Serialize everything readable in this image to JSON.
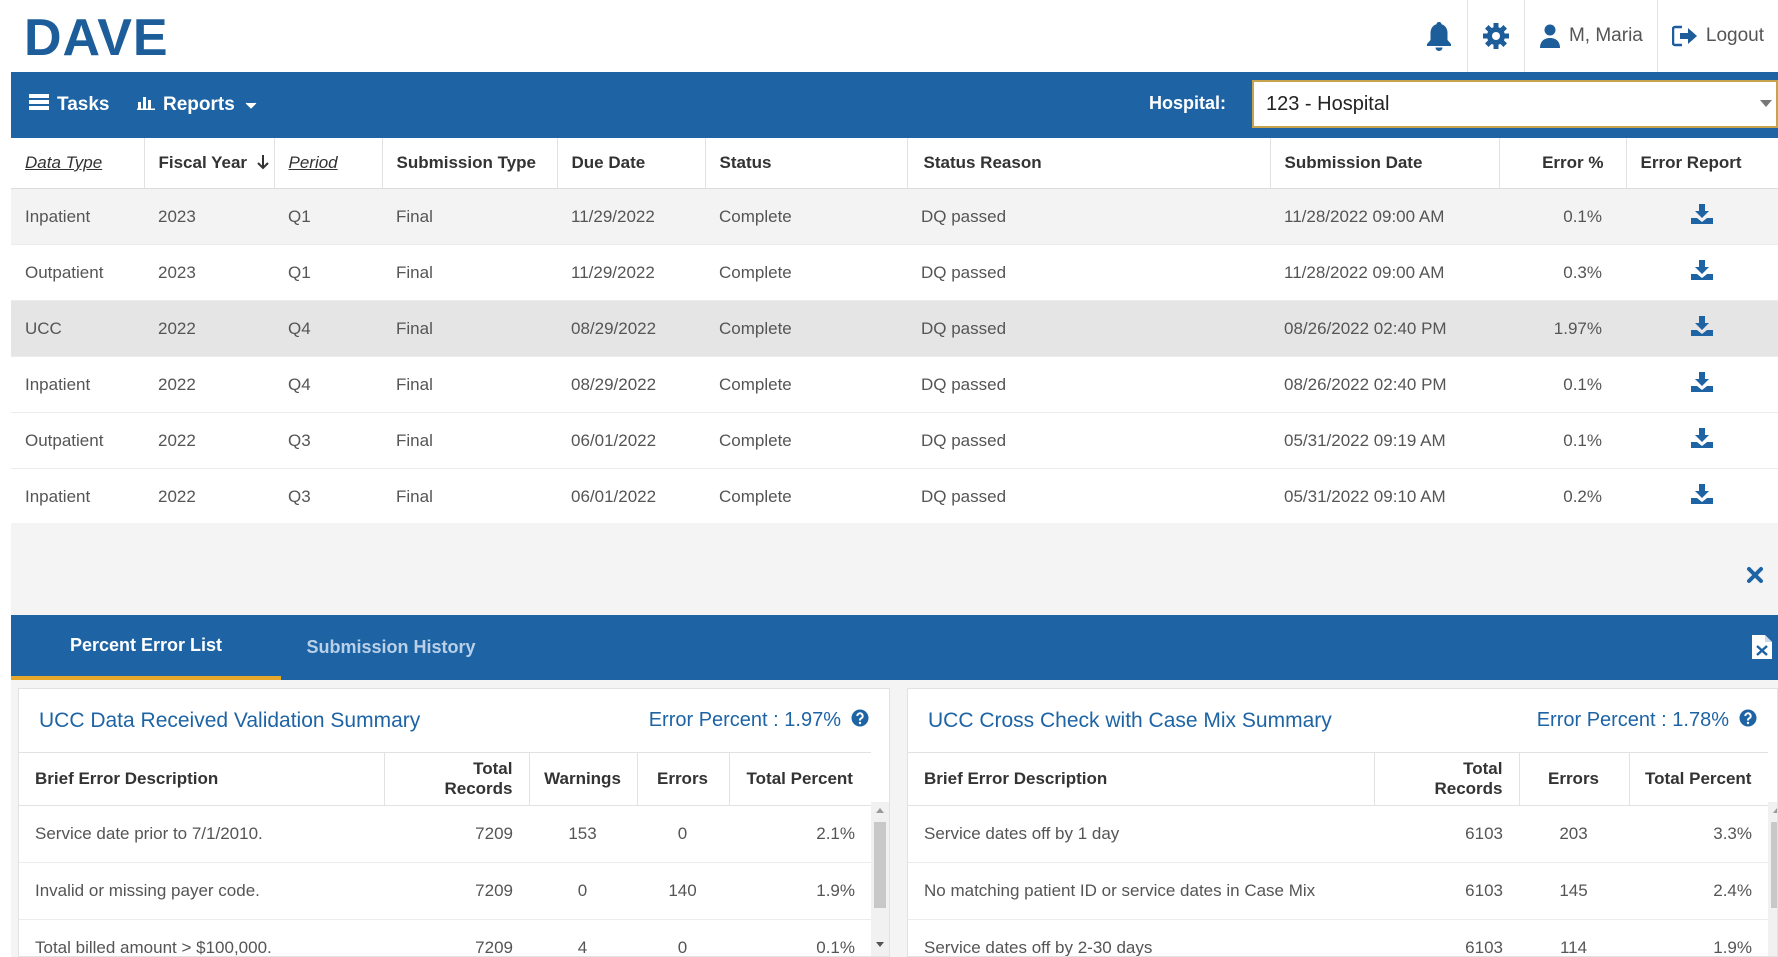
{
  "app": {
    "logo": "DAVE"
  },
  "user": {
    "name": "M, Maria",
    "logout": "Logout"
  },
  "nav": {
    "tasks": "Tasks",
    "reports": "Reports",
    "hospital_label": "Hospital:",
    "hospital_value": "123 - Hospital"
  },
  "main_table": {
    "headers": {
      "data_type": "Data Type",
      "fiscal_year": "Fiscal Year",
      "period": "Period",
      "submission_type": "Submission Type",
      "due_date": "Due Date",
      "status": "Status",
      "status_reason": "Status Reason",
      "submission_date": "Submission Date",
      "error_pct": "Error %",
      "error_report": "Error Report"
    },
    "rows": [
      {
        "data_type": "Inpatient",
        "fiscal_year": "2023",
        "period": "Q1",
        "submission_type": "Final",
        "due_date": "11/29/2022",
        "status": "Complete",
        "status_reason": "DQ passed",
        "submission_date": "11/28/2022 09:00 AM",
        "error_pct": "0.1%"
      },
      {
        "data_type": "Outpatient",
        "fiscal_year": "2023",
        "period": "Q1",
        "submission_type": "Final",
        "due_date": "11/29/2022",
        "status": "Complete",
        "status_reason": "DQ passed",
        "submission_date": "11/28/2022 09:00 AM",
        "error_pct": "0.3%"
      },
      {
        "data_type": "UCC",
        "fiscal_year": "2022",
        "period": "Q4",
        "submission_type": "Final",
        "due_date": "08/29/2022",
        "status": "Complete",
        "status_reason": "DQ passed",
        "submission_date": "08/26/2022 02:40 PM",
        "error_pct": "1.97%"
      },
      {
        "data_type": "Inpatient",
        "fiscal_year": "2022",
        "period": "Q4",
        "submission_type": "Final",
        "due_date": "08/29/2022",
        "status": "Complete",
        "status_reason": "DQ passed",
        "submission_date": "08/26/2022 02:40 PM",
        "error_pct": "0.1%"
      },
      {
        "data_type": "Outpatient",
        "fiscal_year": "2022",
        "period": "Q3",
        "submission_type": "Final",
        "due_date": "06/01/2022",
        "status": "Complete",
        "status_reason": "DQ passed",
        "submission_date": "05/31/2022 09:19 AM",
        "error_pct": "0.1%"
      },
      {
        "data_type": "Inpatient",
        "fiscal_year": "2022",
        "period": "Q3",
        "submission_type": "Final",
        "due_date": "06/01/2022",
        "status": "Complete",
        "status_reason": "DQ passed",
        "submission_date": "05/31/2022 09:10 AM",
        "error_pct": "0.2%"
      }
    ]
  },
  "tabs": {
    "percent_error_list": "Percent Error List",
    "submission_history": "Submission History"
  },
  "left_panel": {
    "title": "UCC Data Received Validation Summary",
    "error_percent": "Error Percent : 1.97%",
    "headers": {
      "desc": "Brief Error Description",
      "total": "Total Records",
      "warnings": "Warnings",
      "errors": "Errors",
      "pct": "Total Percent"
    },
    "rows": [
      {
        "desc": "Service date prior to 7/1/2010.",
        "total": "7209",
        "warnings": "153",
        "errors": "0",
        "pct": "2.1%"
      },
      {
        "desc": "Invalid or missing payer code.",
        "total": "7209",
        "warnings": "0",
        "errors": "140",
        "pct": "1.9%"
      },
      {
        "desc": "Total billed amount > $100,000.",
        "total": "7209",
        "warnings": "4",
        "errors": "0",
        "pct": "0.1%"
      }
    ]
  },
  "right_panel": {
    "title": "UCC Cross Check with Case Mix Summary",
    "error_percent": "Error Percent : 1.78%",
    "headers": {
      "desc": "Brief Error Description",
      "total": "Total Records",
      "errors": "Errors",
      "pct": "Total Percent"
    },
    "rows": [
      {
        "desc": "Service dates off by 1 day",
        "total": "6103",
        "errors": "203",
        "pct": "3.3%"
      },
      {
        "desc": "No matching patient ID or service dates in Case Mix",
        "total": "6103",
        "errors": "145",
        "pct": "2.4%"
      },
      {
        "desc": "Service dates off by 2-30 days",
        "total": "6103",
        "errors": "114",
        "pct": "1.9%"
      }
    ]
  },
  "colors": {
    "primary": "#1e64a5",
    "logo": "#1c5d9a",
    "tab_active_underline": "#e6a82a",
    "hospital_border": "#c8a34e"
  },
  "icons": [
    "bell-icon",
    "gear-icon",
    "user-icon",
    "logout-icon",
    "tasks-icon",
    "reports-chart-icon",
    "download-icon",
    "close-icon",
    "help-icon",
    "excel-icon",
    "sort-down-arrow-icon"
  ]
}
